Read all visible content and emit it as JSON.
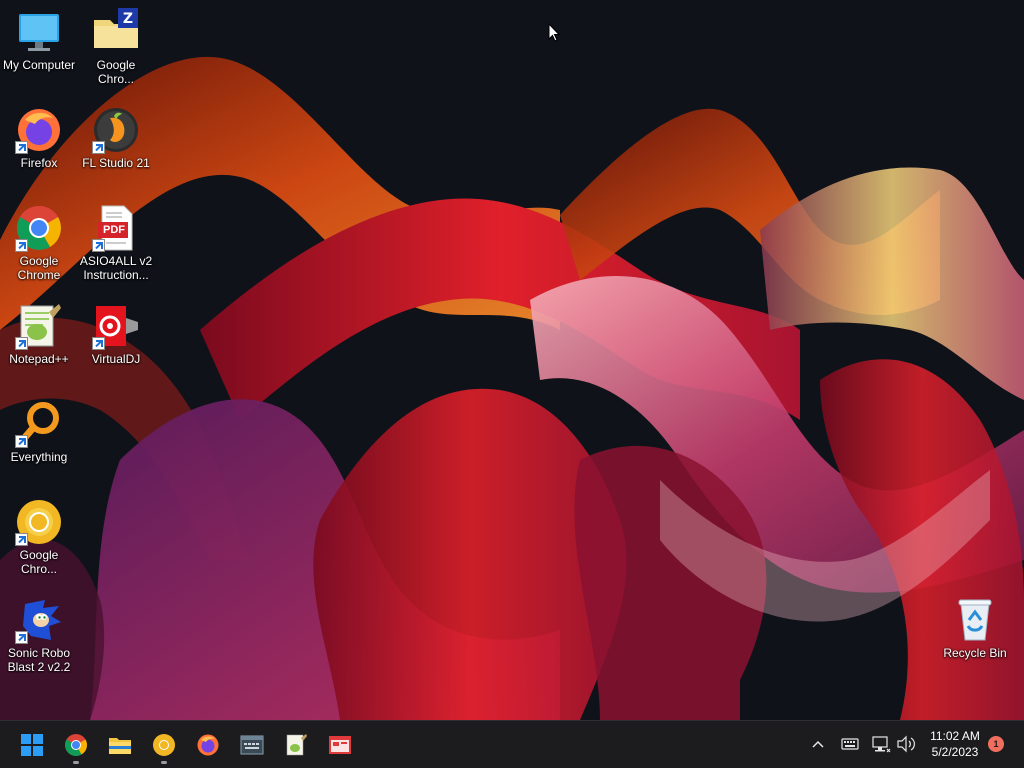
{
  "desktop": {
    "icons": [
      {
        "label": "My Computer",
        "icon": "monitor-icon"
      },
      {
        "label": "Google Chro...",
        "icon": "zip-folder-icon"
      },
      {
        "label": "Firefox",
        "icon": "firefox-icon"
      },
      {
        "label": "FL Studio 21",
        "icon": "fl-studio-icon"
      },
      {
        "label": "Google Chrome",
        "icon": "chrome-icon"
      },
      {
        "label": "ASIO4ALL v2 Instruction...",
        "icon": "pdf-icon",
        "badge": "PDF"
      },
      {
        "label": "Notepad++",
        "icon": "notepadpp-icon"
      },
      {
        "label": "VirtualDJ",
        "icon": "virtualdj-icon"
      },
      {
        "label": "Everything",
        "icon": "everything-search-icon"
      },
      {
        "label": "Google Chro...",
        "icon": "chrome-canary-icon"
      },
      {
        "label": "Sonic Robo Blast 2 v2.2",
        "icon": "sonic-icon"
      },
      {
        "label": "Recycle Bin",
        "icon": "recycle-bin-icon"
      }
    ]
  },
  "taskbar": {
    "items": [
      {
        "name": "start",
        "icon": "windows-start-icon"
      },
      {
        "name": "chrome",
        "icon": "chrome-icon",
        "running": true
      },
      {
        "name": "file-explorer",
        "icon": "folder-icon"
      },
      {
        "name": "chrome-canary",
        "icon": "chrome-canary-icon",
        "running": true
      },
      {
        "name": "firefox",
        "icon": "firefox-icon"
      },
      {
        "name": "keyboard-app",
        "icon": "keyboard-window-icon"
      },
      {
        "name": "notepadpp",
        "icon": "notepadpp-icon"
      },
      {
        "name": "app-window",
        "icon": "red-window-icon"
      }
    ],
    "tray": {
      "icons": [
        "chevron-up-icon",
        "keyboard-icon",
        "network-icon",
        "volume-icon"
      ],
      "time": "11:02 AM",
      "date": "5/2/2023",
      "notification_count": "1"
    }
  },
  "colors": {
    "taskbar_bg": "#1c1c1f",
    "desktop_bg": "#11131b",
    "accent": "#0078d4"
  }
}
